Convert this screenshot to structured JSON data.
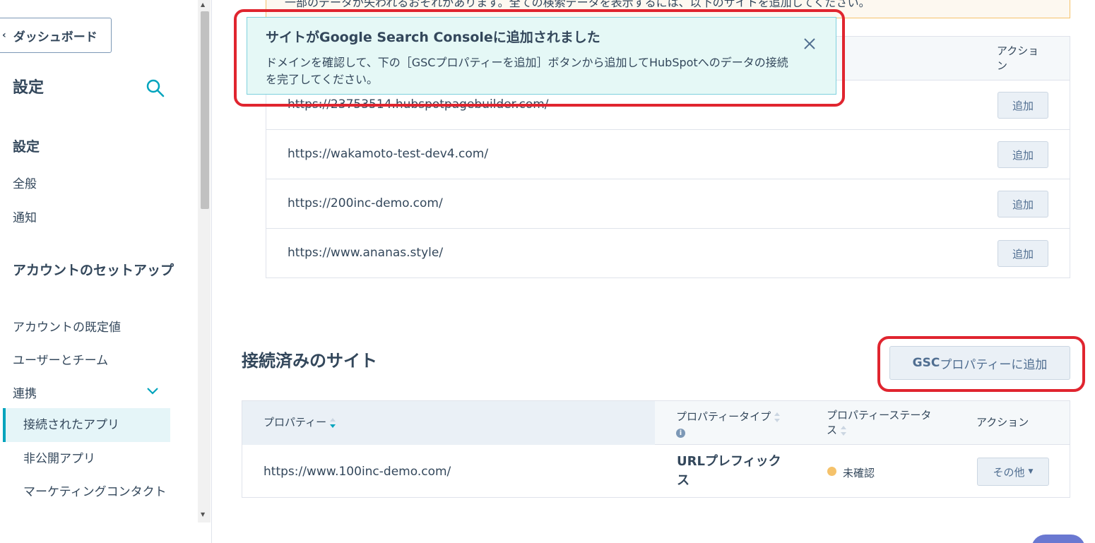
{
  "sidebar": {
    "back_label": "ダッシュボード",
    "title": "設定",
    "section_settings": "設定",
    "item_general": "全般",
    "item_notifications": "通知",
    "section_account": "アカウントのセットアップ",
    "item_defaults": "アカウントの既定値",
    "item_users": "ユーザーとチーム",
    "item_integrations": "連携",
    "sub_connected_apps": "接続されたアプリ",
    "sub_private_apps": "非公開アプリ",
    "sub_marketing_contacts": "マーケティングコンタクト"
  },
  "warning": {
    "text": "一部のデータが失われるおそれがあります。全ての検索データを表示するには、以下のサイトを追加してください。"
  },
  "toast": {
    "title": "サイトがGoogle Search Consoleに追加されました",
    "body": "ドメインを確認して、下の［GSCプロパティーを追加］ボタンから追加してHubSpotへのデータの接続を完了してください。"
  },
  "sites_table": {
    "action_header": "アクション",
    "add_label": "追加",
    "rows": [
      {
        "url": "https://23753514.hubspotpagebuilder.com/"
      },
      {
        "url": "https://wakamoto-test-dev4.com/"
      },
      {
        "url": "https://200inc-demo.com/"
      },
      {
        "url": "https://www.ananas.style/"
      }
    ]
  },
  "connected": {
    "title": "接続済みのサイト",
    "gsc_button_bold": "GSC",
    "gsc_button_rest": "プロパティーに追加",
    "headers": {
      "property": "プロパティー",
      "property_type": "プロパティータイプ",
      "property_status": "プロパティーステータス",
      "action": "アクション"
    },
    "row": {
      "url": "https://www.100inc-demo.com/",
      "type": "URLプレフィックス",
      "status": "未確認",
      "other_label": "その他"
    }
  },
  "colors": {
    "accent": "#00a4bd",
    "highlight_red": "#e0252f",
    "status_unverified": "#f5c26b",
    "toast_bg": "#e5f8f6"
  }
}
